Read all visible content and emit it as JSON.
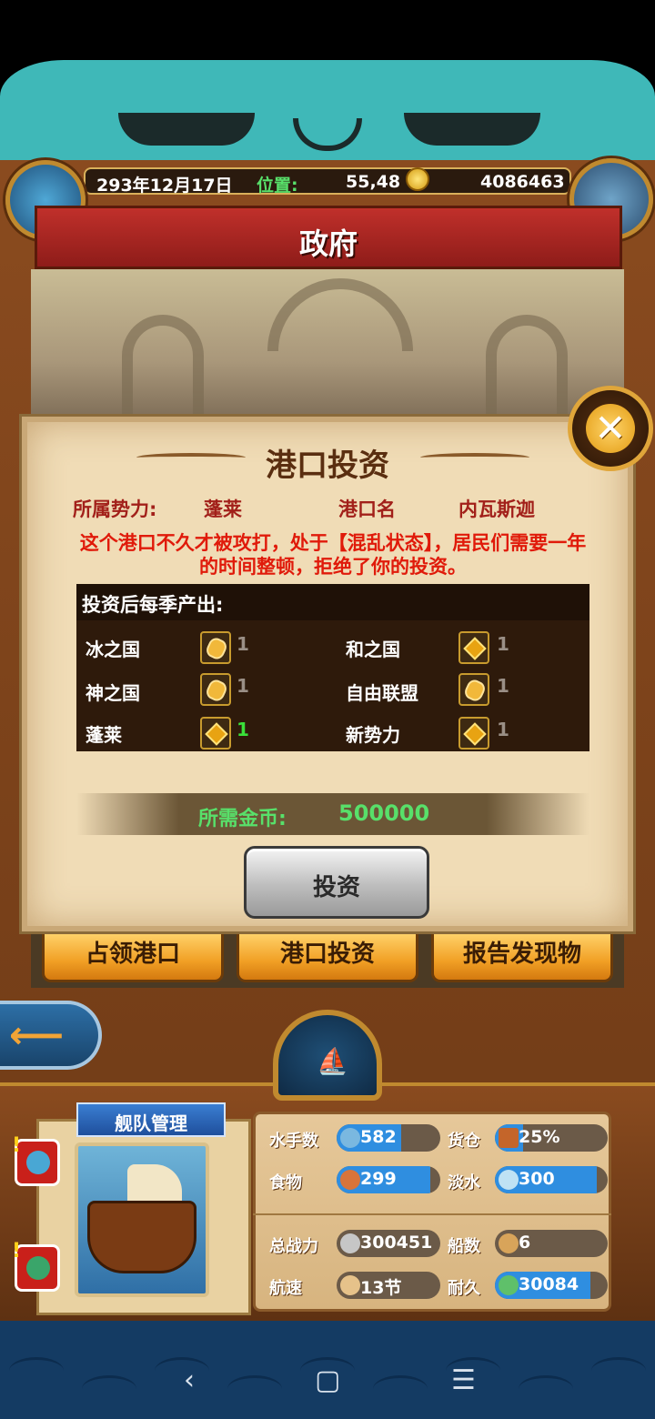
{
  "header": {
    "date": "293年12月17日",
    "location_label": "位置:",
    "location_value": "55,48",
    "gold": "4086463",
    "title": "政府"
  },
  "dialog": {
    "title": "港口投资",
    "faction_label": "所属势力:",
    "faction_value": "蓬莱",
    "port_label": "港口名",
    "port_value": "内瓦斯迦",
    "warning": "这个港口不久才被攻打，处于【混乱状态】，居民们需要一年的时间整顿，拒绝了你的投资。",
    "production_header": "投资后每季产出:",
    "production": [
      {
        "name": "冰之国",
        "icon": "gold-ore-icon",
        "value": "1"
      },
      {
        "name": "和之国",
        "icon": "gold-gem-icon",
        "value": "1"
      },
      {
        "name": "神之国",
        "icon": "gold-ore-icon",
        "value": "1"
      },
      {
        "name": "自由联盟",
        "icon": "gold-ore-icon",
        "value": "1"
      },
      {
        "name": "蓬莱",
        "icon": "gold-gem-icon",
        "value": "1"
      },
      {
        "name": "新势力",
        "icon": "gold-gem-icon",
        "value": "1"
      }
    ],
    "cost_label": "所需金币:",
    "cost_value": "500000",
    "invest_button": "投资",
    "close_icon": "close-icon"
  },
  "actions": {
    "occupy": "占领港口",
    "invest": "港口投资",
    "report": "报告发现物"
  },
  "fleet": {
    "title": "舰队管理",
    "stats": {
      "sailors_label": "水手数",
      "sailors": "582",
      "sailors_fill": 0.62,
      "cargo_label": "货仓",
      "cargo": "25%",
      "cargo_fill": 0.25,
      "food_label": "食物",
      "food": "299",
      "food_fill": 0.9,
      "water_label": "淡水",
      "water": "300",
      "water_fill": 0.9,
      "power_label": "总战力",
      "power": "300451",
      "ships_label": "船数",
      "ships": "6",
      "speed_label": "航速",
      "speed": "13节",
      "durability_label": "耐久",
      "durability": "30084",
      "durability_fill": 0.85
    }
  },
  "navbar": {
    "back": "‹",
    "home": "▢",
    "menu": "☰"
  },
  "colors": {
    "title_red": "#c0302b",
    "warning_red": "#e01a0a",
    "cost_green": "#58e06a",
    "bar_blue": "#2f8ee0",
    "button_orange": "#f1a025"
  }
}
